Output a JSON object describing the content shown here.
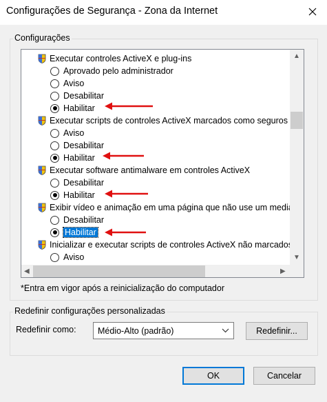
{
  "window": {
    "title": "Configurações de Segurança - Zona da Internet"
  },
  "settings_group": {
    "label": "Configurações"
  },
  "list": {
    "rows": [
      {
        "kind": "header",
        "text": "Executar controles ActiveX e plug-ins"
      },
      {
        "kind": "option",
        "text": "Aprovado pelo administrador",
        "selected": false
      },
      {
        "kind": "option",
        "text": "Aviso",
        "selected": false
      },
      {
        "kind": "option",
        "text": "Desabilitar",
        "selected": false
      },
      {
        "kind": "option",
        "text": "Habilitar",
        "selected": true
      },
      {
        "kind": "header",
        "text": "Executar scripts de controles ActiveX marcados como seguros"
      },
      {
        "kind": "option",
        "text": "Aviso",
        "selected": false
      },
      {
        "kind": "option",
        "text": "Desabilitar",
        "selected": false
      },
      {
        "kind": "option",
        "text": "Habilitar",
        "selected": true
      },
      {
        "kind": "header",
        "text": "Executar software antimalware em controles ActiveX"
      },
      {
        "kind": "option",
        "text": "Desabilitar",
        "selected": false
      },
      {
        "kind": "option",
        "text": "Habilitar",
        "selected": true
      },
      {
        "kind": "header",
        "text": "Exibir vídeo e animação em uma página que não use um media player externo"
      },
      {
        "kind": "option",
        "text": "Desabilitar",
        "selected": false
      },
      {
        "kind": "option",
        "text": "Habilitar",
        "selected": true,
        "focused": true
      },
      {
        "kind": "header",
        "text": "Inicializar e executar scripts de controles ActiveX não marcados como seguros"
      },
      {
        "kind": "option",
        "text": "Aviso",
        "selected": false
      }
    ]
  },
  "note": "*Entra em vigor após a reinicialização do computador",
  "reset_group": {
    "label": "Redefinir configurações personalizadas",
    "reset_to_label": "Redefinir como:",
    "combo_value": "Médio-Alto (padrão)",
    "reset_button": "Redefinir..."
  },
  "buttons": {
    "ok": "OK",
    "cancel": "Cancelar"
  },
  "colors": {
    "highlight": "#0078d7",
    "annotation_arrow": "#e01010"
  }
}
